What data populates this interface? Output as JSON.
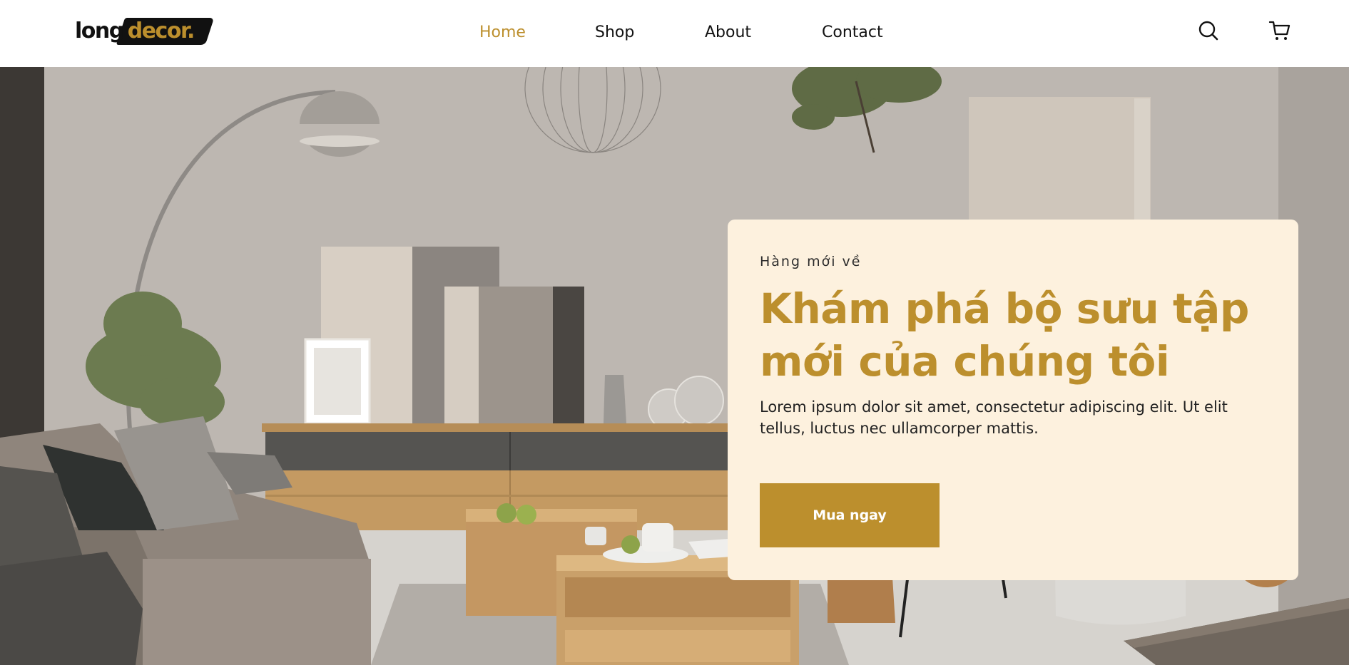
{
  "brand": {
    "logo_part1": "long",
    "logo_part2": "decor.",
    "accent_color": "#bc8f2d",
    "card_bg_color": "#fdf1de"
  },
  "nav": {
    "items": [
      {
        "label": "Home",
        "active": true
      },
      {
        "label": "Shop",
        "active": false
      },
      {
        "label": "About",
        "active": false
      },
      {
        "label": "Contact",
        "active": false
      }
    ]
  },
  "header_icons": {
    "search": "search-icon",
    "cart": "cart-icon"
  },
  "hero": {
    "eyebrow": "Hàng mới về",
    "title": "Khám phá bộ sưu tập mới của chúng tôi",
    "description": "Lorem ipsum dolor sit amet, consectetur adipiscing elit. Ut elit tellus, luctus nec ullamcorper mattis.",
    "cta_label": "Mua ngay"
  }
}
